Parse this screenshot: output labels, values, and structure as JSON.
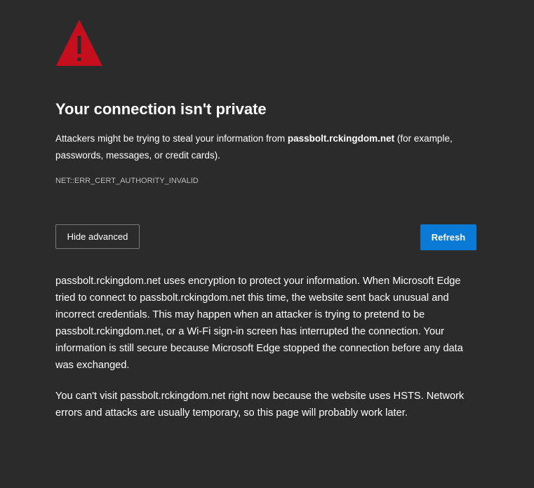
{
  "page": {
    "title": "Your connection isn't private",
    "intro_prefix": "Attackers might be trying to steal your information from ",
    "intro_domain": "passbolt.rckingdom.net",
    "intro_suffix": " (for example, passwords, messages, or credit cards).",
    "error_code": "NET::ERR_CERT_AUTHORITY_INVALID",
    "hide_advanced_label": "Hide advanced",
    "refresh_label": "Refresh",
    "advanced_paragraph_1": "passbolt.rckingdom.net uses encryption to protect your information. When Microsoft Edge tried to connect to passbolt.rckingdom.net this time, the website sent back unusual and incorrect credentials. This may happen when an attacker is trying to pretend to be passbolt.rckingdom.net, or a Wi-Fi sign-in screen has interrupted the connection. Your information is still secure because Microsoft Edge stopped the connection before any data was exchanged.",
    "advanced_paragraph_2": "You can't visit passbolt.rckingdom.net right now because the website uses HSTS. Network errors and attacks are usually temporary, so this page will probably work later."
  },
  "icons": {
    "warning": "warning-triangle-icon"
  },
  "colors": {
    "background": "#2b2b2b",
    "warning_red": "#c50f1f",
    "refresh_blue": "#0b79d6",
    "error_code_gray": "#bdbdbd"
  }
}
